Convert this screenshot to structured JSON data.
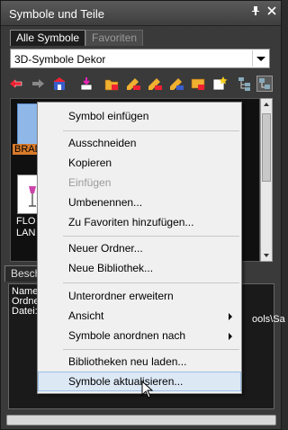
{
  "window": {
    "title": "Symbole und Teile",
    "pin_glyph": "ᵖ",
    "close_glyph": "x"
  },
  "tabs": [
    {
      "label": "Alle Symbole",
      "active": true
    },
    {
      "label": "Favoriten",
      "active": false
    }
  ],
  "library_select": {
    "value": "3D-Symbole Dekor"
  },
  "toolbar": {
    "icons": [
      "back-arrow-icon",
      "forward-arrow-icon",
      "library-home-icon",
      "insert-symbol-icon",
      "new-folder-icon",
      "edit-symbol-icon",
      "delete-symbol-icon",
      "copy-symbol-icon",
      "move-symbol-icon",
      "new-symbol-icon",
      "tree-view-icon",
      "options-icon"
    ]
  },
  "symbols": [
    {
      "label": "BRAD"
    },
    {
      "label": "FLO\nLAN"
    }
  ],
  "description": {
    "tab_label": "Besch",
    "lines": [
      "Name",
      "Ordne",
      "Datei:"
    ],
    "tail_text": "ools\\Sa"
  },
  "context_menu": {
    "items": [
      {
        "label": "Symbol einfügen",
        "disabled": false
      },
      {
        "label": "Ausschneiden",
        "disabled": false
      },
      {
        "label": "Kopieren",
        "disabled": false
      },
      {
        "label": "Einfügen",
        "disabled": true
      },
      {
        "label": "Umbenennen...",
        "disabled": false
      },
      {
        "label": "Zu Favoriten hinzufügen...",
        "disabled": false
      },
      {
        "label": "Neuer Ordner...",
        "disabled": false
      },
      {
        "label": "Neue Bibliothek...",
        "disabled": false
      },
      {
        "label": "Unterordner erweitern",
        "disabled": false
      },
      {
        "label": "Ansicht",
        "disabled": false,
        "submenu": true
      },
      {
        "label": "Symbole anordnen nach",
        "disabled": false,
        "submenu": true
      },
      {
        "label": "Bibliotheken neu laden...",
        "disabled": false
      },
      {
        "label": "Symbole aktualisieren...",
        "disabled": false,
        "hover": true
      }
    ]
  }
}
